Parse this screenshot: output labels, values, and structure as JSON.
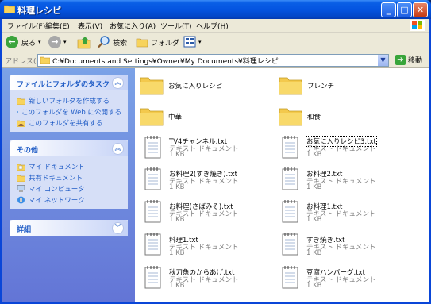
{
  "window": {
    "title": "料理レシピ"
  },
  "menu": [
    "ファイル(F)",
    "編集(E)",
    "表示(V)",
    "お気に入り(A)",
    "ツール(T)",
    "ヘルプ(H)"
  ],
  "toolbar": {
    "back": "戻る",
    "search": "検索",
    "folders": "フォルダ"
  },
  "address": {
    "label": "アドレス(D)",
    "value": "C:¥Documents and Settings¥Owner¥My Documents¥料理レシピ",
    "go": "移動"
  },
  "tasks": {
    "title": "ファイルとフォルダのタスク",
    "items": [
      "新しいフォルダを作成する",
      "このフォルダを Web に公開する",
      "このフォルダを共有する"
    ]
  },
  "other": {
    "title": "その他",
    "items": [
      "マイ ドキュメント",
      "共有ドキュメント",
      "マイ コンピュータ",
      "マイ ネットワーク"
    ]
  },
  "details": {
    "title": "詳細"
  },
  "folders": [
    "お気に入りレシピ",
    "フレンチ",
    "中華",
    "和食"
  ],
  "files": [
    {
      "name": "TV4チャンネル.txt",
      "type": "テキスト ドキュメント",
      "size": "1 KB"
    },
    {
      "name": "お気に入りレシピ3.txt",
      "type": "テキスト ドキュメント",
      "size": "1 KB"
    },
    {
      "name": "お料理2(すき焼き).txt",
      "type": "テキスト ドキュメント",
      "size": "1 KB"
    },
    {
      "name": "お料理2.txt",
      "type": "テキスト ドキュメント",
      "size": "1 KB"
    },
    {
      "name": "お料理(さばみそ).txt",
      "type": "テキスト ドキュメント",
      "size": "1 KB"
    },
    {
      "name": "お料理1.txt",
      "type": "テキスト ドキュメント",
      "size": "1 KB"
    },
    {
      "name": "料理1.txt",
      "type": "テキスト ドキュメント",
      "size": "1 KB"
    },
    {
      "name": "すき焼き.txt",
      "type": "テキスト ドキュメント",
      "size": "1 KB"
    },
    {
      "name": "秋刀魚のからあげ.txt",
      "type": "テキスト ドキュメント",
      "size": "1 KB"
    },
    {
      "name": "豆腐ハンバーグ.txt",
      "type": "テキスト ドキュメント",
      "size": "1 KB"
    }
  ],
  "colors": {
    "titlebar": "#0454e0",
    "leftpane": "#7ba2e7",
    "link": "#215dc6"
  }
}
